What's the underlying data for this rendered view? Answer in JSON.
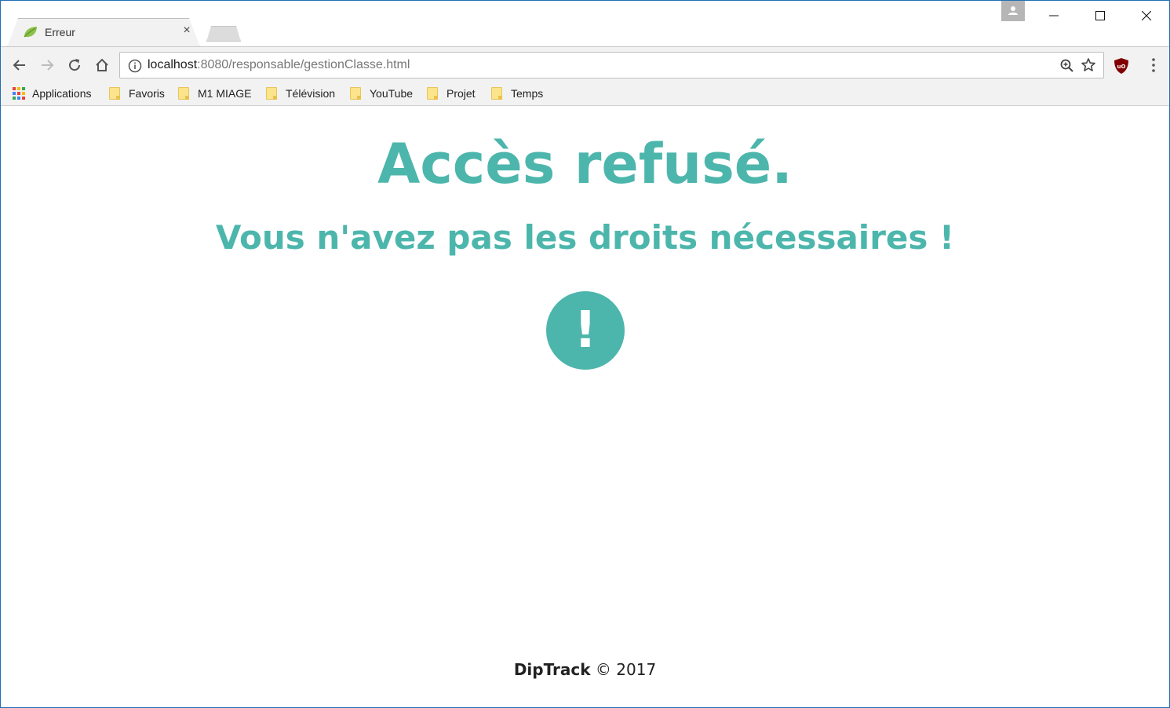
{
  "browser": {
    "tab": {
      "title": "Erreur",
      "close_glyph": "×"
    },
    "address_bar": {
      "url_host": "localhost",
      "url_rest": ":8080/responsable/gestionClasse.html"
    },
    "bookmarks": [
      {
        "label": "Applications",
        "icon": "apps-grid-icon"
      },
      {
        "label": "Favoris",
        "icon": "folder-icon"
      },
      {
        "label": "M1 MIAGE",
        "icon": "folder-icon"
      },
      {
        "label": "Télévision",
        "icon": "folder-icon"
      },
      {
        "label": "YouTube",
        "icon": "folder-icon"
      },
      {
        "label": "Projet",
        "icon": "folder-icon"
      },
      {
        "label": "Temps",
        "icon": "folder-icon"
      }
    ],
    "accent_color": "#4db6ac"
  },
  "page": {
    "title": "Accès refusé.",
    "subtitle": "Vous n'avez pas les droits nécessaires !",
    "alert_glyph": "!",
    "footer": {
      "brand": "DipTrack",
      "copyright": "© 2017"
    }
  }
}
